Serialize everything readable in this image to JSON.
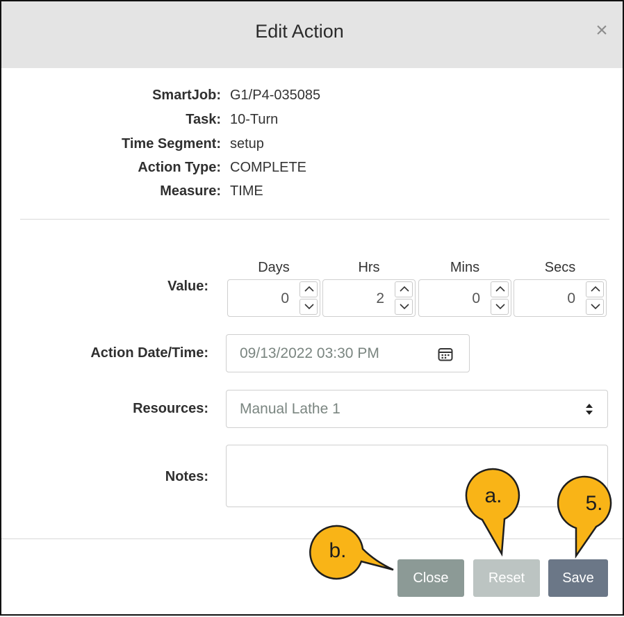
{
  "dialog": {
    "title": "Edit Action",
    "close_glyph": "×"
  },
  "info": [
    {
      "label": "SmartJob:",
      "value": "G1/P4-035085"
    },
    {
      "label": "Task:",
      "value": "10-Turn"
    },
    {
      "label": "Time Segment:",
      "value": "setup"
    },
    {
      "label": "Action Type:",
      "value": "COMPLETE"
    },
    {
      "label": "Measure:",
      "value": "TIME"
    }
  ],
  "form": {
    "value_label": "Value:",
    "duration": [
      {
        "header": "Days",
        "value": "0"
      },
      {
        "header": "Hrs",
        "value": "2"
      },
      {
        "header": "Mins",
        "value": "0"
      },
      {
        "header": "Secs",
        "value": "0"
      }
    ],
    "datetime_label": "Action Date/Time:",
    "datetime_value": "09/13/2022 03:30 PM",
    "resources_label": "Resources:",
    "resources_value": "Manual Lathe 1",
    "notes_label": "Notes:",
    "notes_value": ""
  },
  "buttons": {
    "close": "Close",
    "reset": "Reset",
    "save": "Save"
  },
  "callouts": {
    "b": "b.",
    "a": "a.",
    "five": "5."
  },
  "colors": {
    "header_bg": "#e4e4e4",
    "close_button": "#8c9a96",
    "reset_button": "#bcc4c2",
    "save_button": "#6b7787",
    "callout_fill": "#f9b417"
  },
  "icons": {
    "close": "close-icon",
    "calendar": "calendar-icon",
    "select": "sort-arrows-icon",
    "step_up": "chevron-up-icon",
    "step_down": "chevron-down-icon"
  }
}
